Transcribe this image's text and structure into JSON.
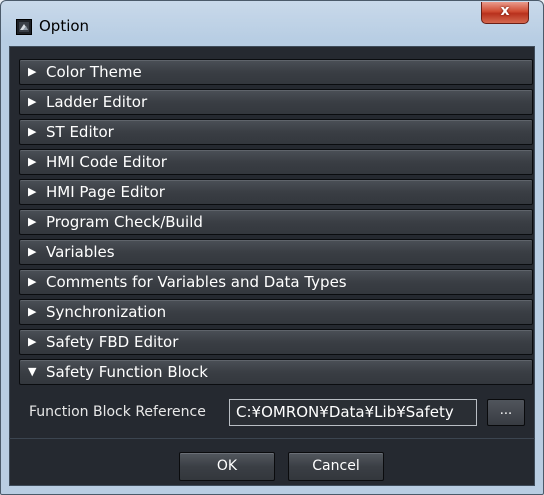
{
  "window": {
    "title": "Option",
    "close_glyph": "x",
    "icon": "app-icon"
  },
  "sections": [
    {
      "label": "Color Theme",
      "expanded": false
    },
    {
      "label": "Ladder Editor",
      "expanded": false
    },
    {
      "label": "ST Editor",
      "expanded": false
    },
    {
      "label": "HMI Code Editor",
      "expanded": false
    },
    {
      "label": "HMI Page Editor",
      "expanded": false
    },
    {
      "label": "Program Check/Build",
      "expanded": false
    },
    {
      "label": "Variables",
      "expanded": false
    },
    {
      "label": "Comments for Variables and Data Types",
      "expanded": false
    },
    {
      "label": "Synchronization",
      "expanded": false
    },
    {
      "label": "Safety FBD Editor",
      "expanded": false
    },
    {
      "label": "Safety Function Block",
      "expanded": true
    }
  ],
  "arrows": {
    "collapsed": "▶",
    "expanded": "▼"
  },
  "function_block_reference": {
    "label": "Function Block Reference",
    "value": "C:¥OMRON¥Data¥Lib¥Safety",
    "browse_label": "..."
  },
  "buttons": {
    "ok": "OK",
    "cancel": "Cancel"
  },
  "colors": {
    "panel_background": "#252930",
    "section_background": "#3a3e44",
    "text": "#ffffff",
    "close_button": "#cf4b32"
  }
}
